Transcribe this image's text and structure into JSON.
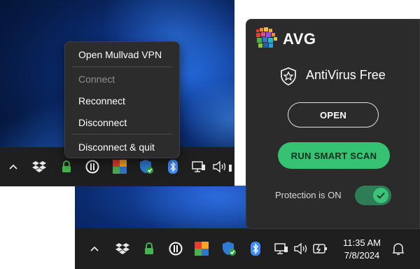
{
  "context_menu": {
    "items": [
      {
        "label": "Open Mullvad VPN",
        "enabled": true
      },
      {
        "label": "Connect",
        "enabled": false
      },
      {
        "label": "Reconnect",
        "enabled": true
      },
      {
        "label": "Disconnect",
        "enabled": true
      },
      {
        "label": "Disconnect & quit",
        "enabled": true
      }
    ]
  },
  "avg_panel": {
    "brand": "AVG",
    "product": "AntiVirus Free",
    "open_button": "OPEN",
    "scan_button": "RUN SMART SCAN",
    "protection_label": "Protection is ON",
    "protection_on": true
  },
  "taskbar": {
    "time": "11:35 AM",
    "date": "7/8/2024",
    "tray_icons": [
      "chevron-up-icon",
      "dropbox-icon",
      "mullvad-lock-icon",
      "mullvad-logo-icon",
      "avg-icon",
      "windows-security-icon",
      "bluetooth-icon",
      "network-icon",
      "volume-icon",
      "battery-icon",
      "notification-bell-icon"
    ]
  },
  "colors": {
    "taskbar": "#1f1f1f",
    "menu_bg": "#2c2c2c",
    "panel_bg": "#2b2b2b",
    "accent_green": "#35c273",
    "mullvad_green": "#44b64d",
    "bluetooth_blue": "#3d8bfd"
  }
}
